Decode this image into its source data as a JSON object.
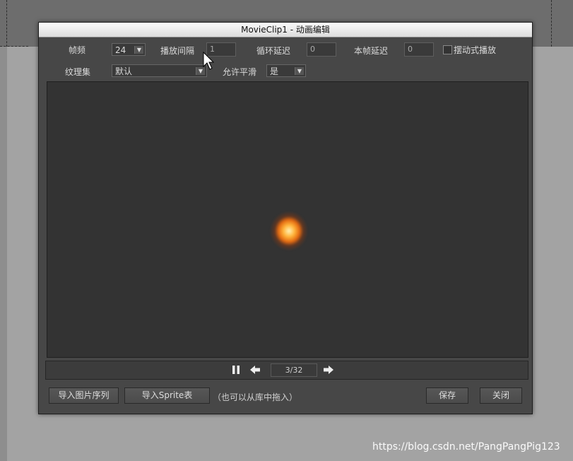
{
  "window": {
    "title": "MovieClip1 - 动画编辑"
  },
  "settings": {
    "fps_label": "帧频",
    "fps_value": "24",
    "interval_label": "播放间隔",
    "interval_value": "1",
    "loop_delay_label": "循环延迟",
    "loop_delay_value": "0",
    "frame_delay_label": "本帧延迟",
    "frame_delay_value": "0",
    "swing_label": "摆动式播放",
    "swing_checked": false,
    "texture_label": "纹理集",
    "texture_value": "默认",
    "smoothing_label": "允许平滑",
    "smoothing_value": "是"
  },
  "player": {
    "frame_indicator": "3/32"
  },
  "footer": {
    "import_sequence_label": "导入图片序列",
    "import_sprite_label": "导入Sprite表",
    "hint": "（也可以从库中拖入）",
    "save_label": "保存",
    "close_label": "关闭"
  },
  "watermark": "https://blog.csdn.net/PangPangPig123"
}
